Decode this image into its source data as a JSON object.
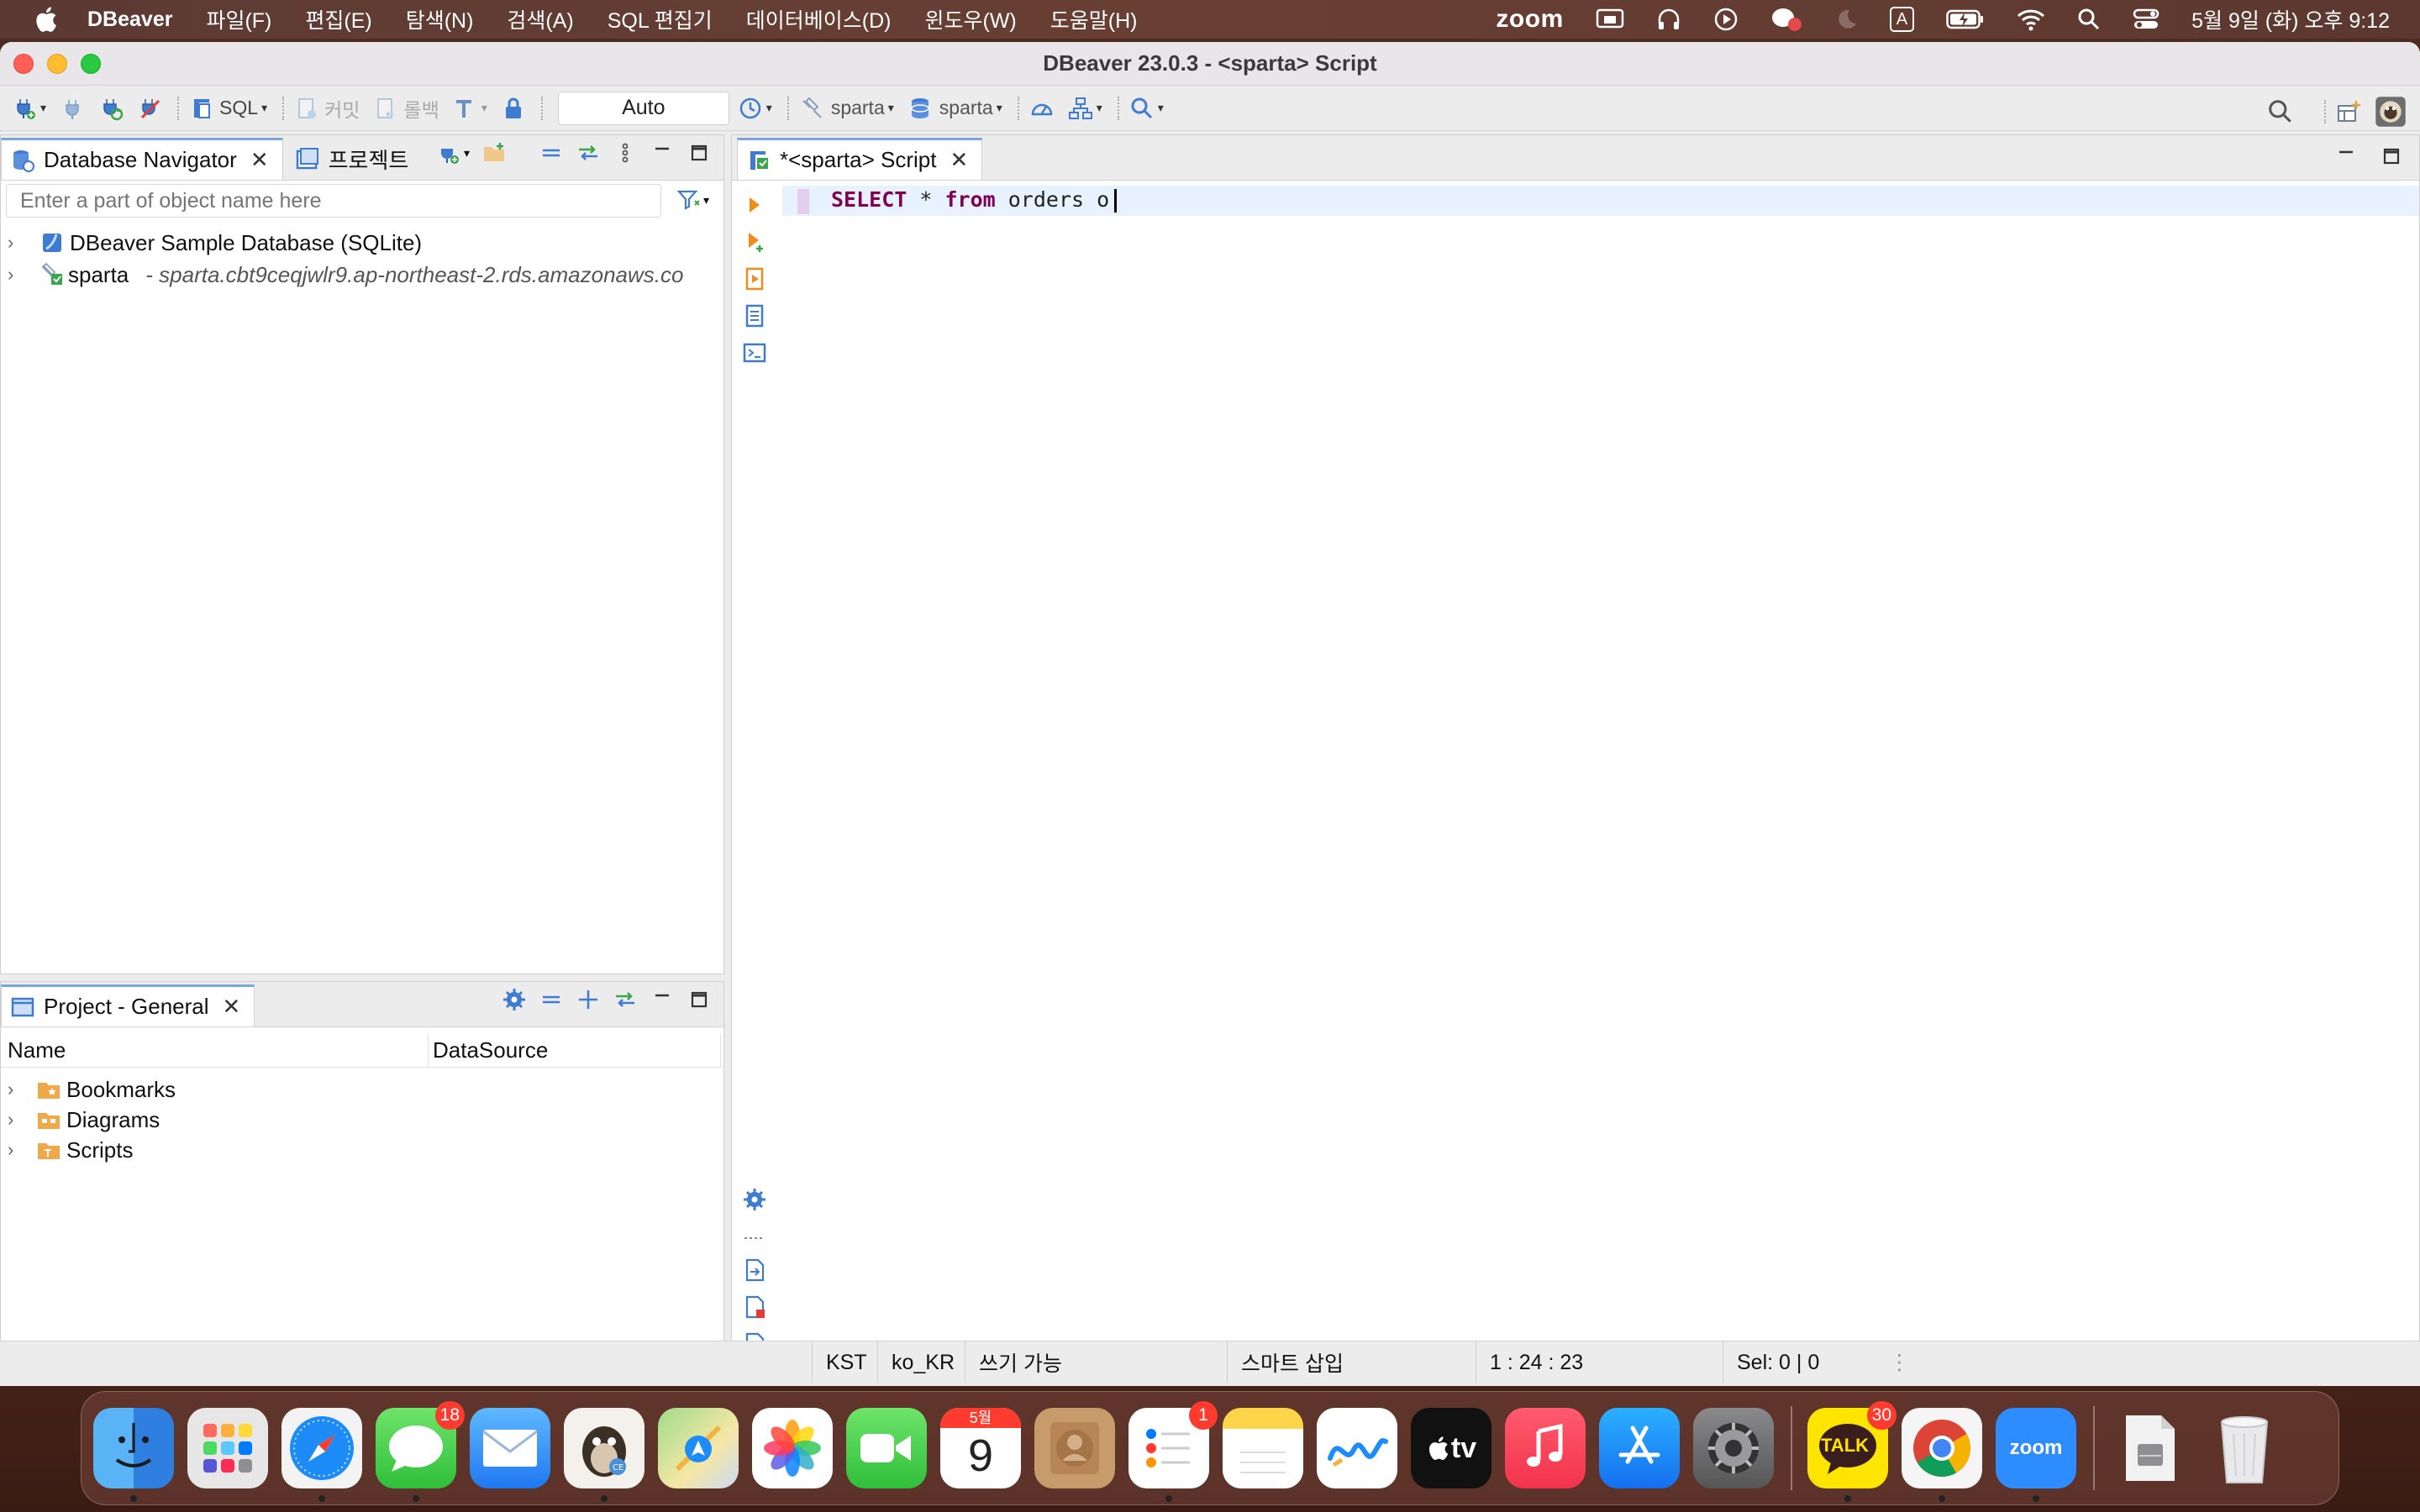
{
  "menubar": {
    "app_name": "DBeaver",
    "menus": [
      "파일(F)",
      "편집(E)",
      "탐색(N)",
      "검색(A)",
      "SQL 편집기",
      "데이터베이스(D)",
      "윈도우(W)",
      "도움말(H)"
    ],
    "zoom_label": "zoom",
    "input_source": "A",
    "datetime": "5월 9일 (화) 오후 9:12"
  },
  "window": {
    "title": "DBeaver 23.0.3 - <sparta> Script"
  },
  "toolbar": {
    "sql_label": "SQL",
    "commit_label": "커밋",
    "rollback_label": "롤백",
    "transaction_mode": "Auto",
    "datasource": "sparta",
    "schema": "sparta"
  },
  "navigator": {
    "tab_label": "Database Navigator",
    "projects_tab_label": "프로젝트",
    "filter_placeholder": "Enter a part of object name here",
    "items": [
      {
        "label": "DBeaver Sample Database (SQLite)",
        "sub": ""
      },
      {
        "label": "sparta",
        "sub": "- sparta.cbt9ceqjwlr9.ap-northeast-2.rds.amazonaws.co"
      }
    ]
  },
  "project": {
    "tab_label": "Project - General",
    "columns": [
      "Name",
      "DataSource"
    ],
    "items": [
      "Bookmarks",
      "Diagrams",
      "Scripts"
    ]
  },
  "editor": {
    "tab_label": "*<sparta> Script",
    "code": {
      "kw1": "SELECT",
      "mid": " * ",
      "kw2": "from",
      "rest": " orders o"
    }
  },
  "statusbar": {
    "timezone": "KST",
    "locale": "ko_KR",
    "writable": "쓰기 가능",
    "insert_mode": "스마트 삽입",
    "position": "1 : 24 : 23",
    "selection": "Sel: 0 | 0"
  },
  "dock": {
    "apps": [
      {
        "name": "Finder",
        "badge": ""
      },
      {
        "name": "Launchpad",
        "badge": ""
      },
      {
        "name": "Safari",
        "badge": ""
      },
      {
        "name": "Messages",
        "badge": "18"
      },
      {
        "name": "Mail",
        "badge": ""
      },
      {
        "name": "DBeaver",
        "badge": ""
      },
      {
        "name": "Maps",
        "badge": ""
      },
      {
        "name": "Photos",
        "badge": ""
      },
      {
        "name": "FaceTime",
        "badge": ""
      },
      {
        "name": "Calendar",
        "badge": ""
      },
      {
        "name": "Contacts",
        "badge": ""
      },
      {
        "name": "Reminders",
        "badge": "1"
      },
      {
        "name": "Notes",
        "badge": ""
      },
      {
        "name": "Freeform",
        "badge": ""
      },
      {
        "name": "TV",
        "badge": ""
      },
      {
        "name": "Music",
        "badge": ""
      },
      {
        "name": "App Store",
        "badge": ""
      },
      {
        "name": "System Settings",
        "badge": ""
      },
      {
        "name": "KakaoTalk",
        "badge": "30"
      },
      {
        "name": "Chrome",
        "badge": ""
      },
      {
        "name": "Zoom",
        "badge": ""
      }
    ],
    "calendar_month": "5월",
    "calendar_day": "9",
    "tv_label": "tv",
    "kakao_label": "TALK",
    "zoom_label": "zoom"
  }
}
